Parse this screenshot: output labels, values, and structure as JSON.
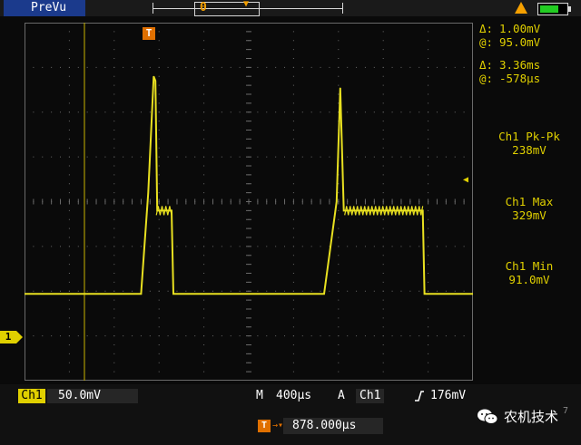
{
  "top_bar": {
    "mode_label": "PreVu",
    "trigger_position_marker": "0",
    "icons": [
      "warning-icon",
      "battery-icon"
    ],
    "battery_level": 0.7
  },
  "side_readouts": {
    "cursor_v_delta_key": "Δ:",
    "cursor_v_delta": "1.00mV",
    "cursor_v_at_key": "@:",
    "cursor_v_at": "95.0mV",
    "cursor_t_delta_key": "Δ:",
    "cursor_t_delta": "3.36ms",
    "cursor_t_at_key": "@:",
    "cursor_t_at": "-578µs"
  },
  "measurements": [
    {
      "label": "Ch1 Pk-Pk",
      "value": "238mV"
    },
    {
      "label": "Ch1 Max",
      "value": "329mV"
    },
    {
      "label": "Ch1 Min",
      "value": "91.0mV"
    }
  ],
  "markers": {
    "channel": "1",
    "trigger": "T"
  },
  "bottom_bar": {
    "channel": "Ch1",
    "volts_per_div": "50.0mV",
    "timebase_key": "M",
    "timebase": "400µs",
    "trigger_key": "A",
    "trigger_channel": "Ch1",
    "trigger_level": "176mV",
    "trigger_pos_marker": "T",
    "trigger_position": "878.000µs",
    "date_fragment": "7"
  },
  "watermark": {
    "text": "农机技术",
    "icon": "wechat-icon"
  },
  "colors": {
    "trace": "#e8e020",
    "graticule": "#6a6a6a",
    "trigger_marker": "#e07000",
    "mode_label_bg": "#1b3a8c"
  },
  "chart_data": {
    "type": "line",
    "xlabel": "",
    "ylabel": "",
    "x": [
      0.0,
      0.65,
      0.69,
      0.72,
      0.73,
      0.74,
      0.82,
      0.83,
      0.87,
      0.92,
      1.67,
      1.74,
      1.76,
      1.78,
      1.79,
      2.22,
      2.23,
      2.26,
      2.31,
      2.5
    ],
    "series": [
      {
        "values": [
          0.97,
          0.97,
          2.1,
          3.4,
          3.35,
          1.9,
          1.9,
          0.97,
          0.97,
          0.97,
          0.97,
          2.0,
          3.27,
          1.9,
          1.9,
          1.9,
          0.97,
          0.97,
          0.97,
          0.97
        ]
      }
    ]
  }
}
